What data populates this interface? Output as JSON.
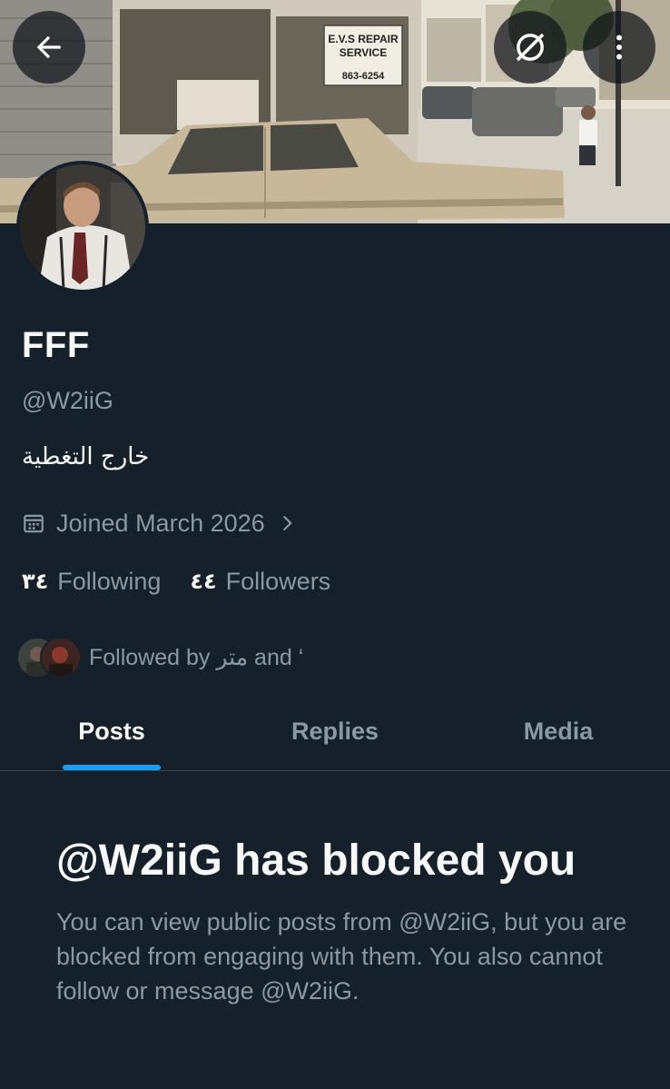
{
  "banner": {
    "sign_text_line1": "E.V.S REPAIR",
    "sign_text_line2": "SERVICE",
    "sign_phone": "863-6254"
  },
  "header": {
    "back_icon": "arrow-left-icon",
    "hide_icon": "eye-slash-icon",
    "more_icon": "more-vertical-icon"
  },
  "profile": {
    "display_name": "FFF",
    "handle": "@W2iiG",
    "bio": "خارج التغطية",
    "joined": "Joined March 2026",
    "following_count": "٣٤",
    "following_label": "Following",
    "followers_count": "٤٤",
    "followers_label": "Followers",
    "followed_by": "Followed by متر and ‘"
  },
  "tabs": [
    {
      "label": "Posts",
      "active": true
    },
    {
      "label": "Replies",
      "active": false
    },
    {
      "label": "Media",
      "active": false
    }
  ],
  "blocked": {
    "title": "@W2iiG has blocked you",
    "message": "You can view public posts from @W2iiG, but you are blocked from engaging with them. You also cannot follow or message @W2iiG."
  },
  "colors": {
    "background": "#15202b",
    "accent": "#1d9bf0",
    "secondary_text": "#8b98a5",
    "primary_text": "#f7f9f9"
  }
}
